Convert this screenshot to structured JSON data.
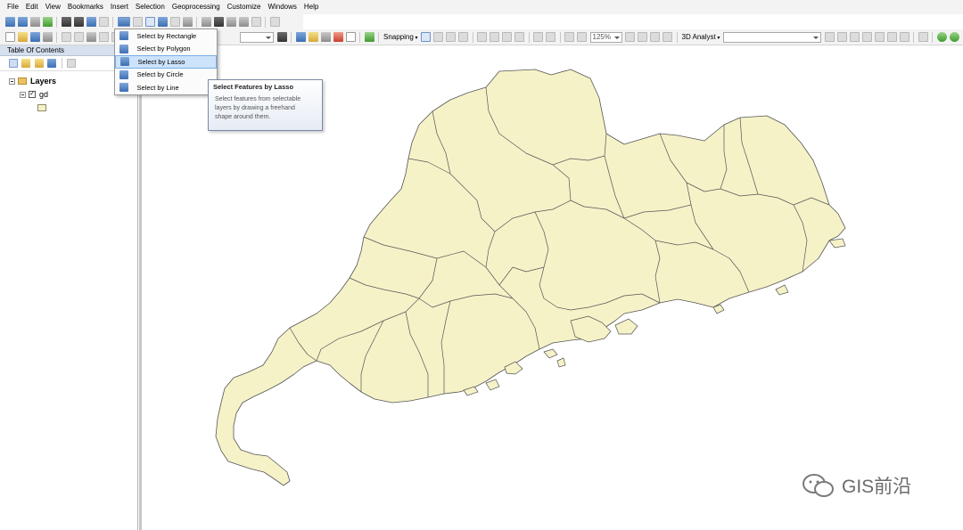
{
  "menu": [
    "File",
    "Edit",
    "View",
    "Bookmarks",
    "Insert",
    "Selection",
    "Geoprocessing",
    "Customize",
    "Windows",
    "Help"
  ],
  "toolbar": {
    "snapping_label": "Snapping",
    "zoom_value": "125%",
    "analyst_label": "3D Analyst"
  },
  "toc": {
    "title": "Table Of Contents",
    "layers_label": "Layers",
    "layer_name": "gd",
    "layer_visible": true
  },
  "select_menu": {
    "items": [
      "Select by Rectangle",
      "Select by Polygon",
      "Select by Lasso",
      "Select by Circle",
      "Select by Line"
    ],
    "active": "Select by Lasso"
  },
  "tooltip": {
    "title": "Select Features by Lasso",
    "body_lines": [
      "Select features from selectable",
      "layers by drawing a freehand",
      "shape around them."
    ]
  },
  "watermark": "GIS前沿",
  "colors": {
    "feature_fill": "#f6f2c8",
    "feature_outline": "#555555",
    "toc_title_bg": "#d6e0ee",
    "menu_highlight": "#cde3fb"
  }
}
